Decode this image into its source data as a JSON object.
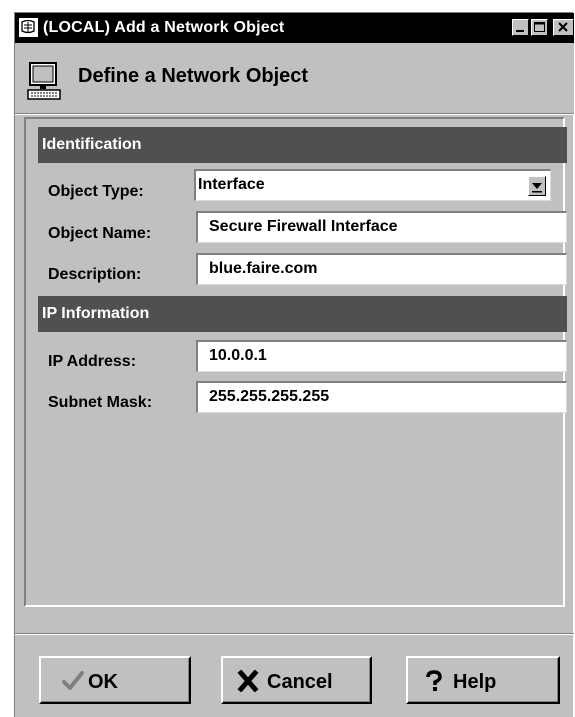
{
  "window": {
    "title": "(LOCAL) Add a Network Object",
    "header_title": "Define a Network Object",
    "icons": [
      "app-icon",
      "minimize-icon",
      "maximize-icon",
      "close-icon",
      "network-object-icon"
    ]
  },
  "identification": {
    "section_title": "Identification",
    "object_type_label": "Object Type:",
    "object_type_value": "Interface",
    "object_name_label": "Object Name:",
    "object_name_value": "Secure Firewall Interface",
    "description_label": "Description:",
    "description_value": "blue.faire.com"
  },
  "ip_information": {
    "section_title": "IP Information",
    "ip_address_label": "IP Address:",
    "ip_address_value": "10.0.0.1",
    "subnet_mask_label": "Subnet Mask:",
    "subnet_mask_value": "255.255.255.255"
  },
  "buttons": {
    "ok_label": "OK",
    "cancel_label": "Cancel",
    "help_label": "Help"
  },
  "colors": {
    "title_bar": "#000000",
    "section_header": "#505050",
    "window_face": "#c0c0c0"
  }
}
